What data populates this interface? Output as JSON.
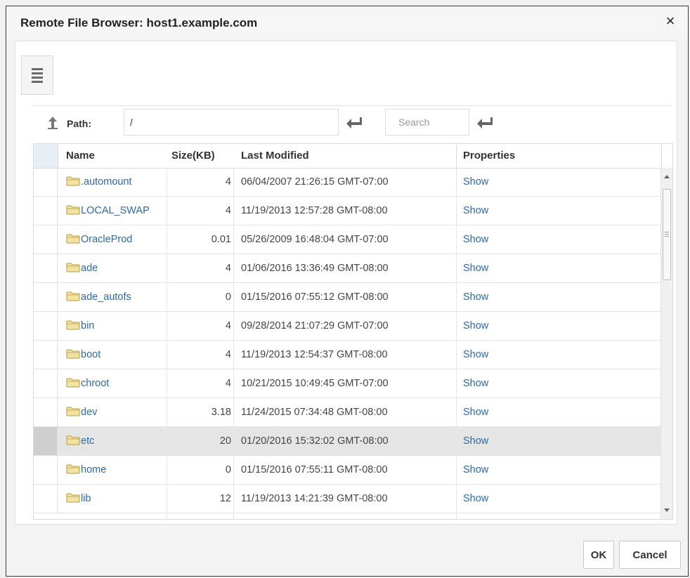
{
  "dialog": {
    "title": "Remote File Browser: host1.example.com",
    "close_label": "×"
  },
  "toolbar": {
    "menu_icon": "list-menu-icon",
    "up_icon": "up-arrow-icon",
    "path_label": "Path:",
    "path_value": "/",
    "search_placeholder": "Search",
    "enter_icon": "return-arrow-icon"
  },
  "table": {
    "columns": [
      "Name",
      "Size(KB)",
      "Last Modified",
      "Properties"
    ],
    "rows": [
      {
        "name": ".automount",
        "size": "4",
        "modified": "06/04/2007 21:26:15 GMT-07:00",
        "properties": "Show"
      },
      {
        "name": "LOCAL_SWAP",
        "size": "4",
        "modified": "11/19/2013 12:57:28 GMT-08:00",
        "properties": "Show"
      },
      {
        "name": "OracleProd",
        "size": "0.01",
        "modified": "05/26/2009 16:48:04 GMT-07:00",
        "properties": "Show"
      },
      {
        "name": "ade",
        "size": "4",
        "modified": "01/06/2016 13:36:49 GMT-08:00",
        "properties": "Show"
      },
      {
        "name": "ade_autofs",
        "size": "0",
        "modified": "01/15/2016 07:55:12 GMT-08:00",
        "properties": "Show"
      },
      {
        "name": "bin",
        "size": "4",
        "modified": "09/28/2014 21:07:29 GMT-07:00",
        "properties": "Show"
      },
      {
        "name": "boot",
        "size": "4",
        "modified": "11/19/2013 12:54:37 GMT-08:00",
        "properties": "Show"
      },
      {
        "name": "chroot",
        "size": "4",
        "modified": "10/21/2015 10:49:45 GMT-07:00",
        "properties": "Show"
      },
      {
        "name": "dev",
        "size": "3.18",
        "modified": "11/24/2015 07:34:48 GMT-08:00",
        "properties": "Show"
      },
      {
        "name": "etc",
        "size": "20",
        "modified": "01/20/2016 15:32:02 GMT-08:00",
        "properties": "Show",
        "selected": true
      },
      {
        "name": "home",
        "size": "0",
        "modified": "01/15/2016 07:55:11 GMT-08:00",
        "properties": "Show"
      },
      {
        "name": "lib",
        "size": "12",
        "modified": "11/19/2013 14:21:39 GMT-08:00",
        "properties": "Show"
      }
    ],
    "row_icon": "folder-icon"
  },
  "footer": {
    "ok_label": "OK",
    "cancel_label": "Cancel"
  },
  "colors": {
    "link": "#2d6aa3",
    "selected_row": "#e5e5e5",
    "folder_fill": "#f3e3a0",
    "folder_stroke": "#b39b4a"
  }
}
